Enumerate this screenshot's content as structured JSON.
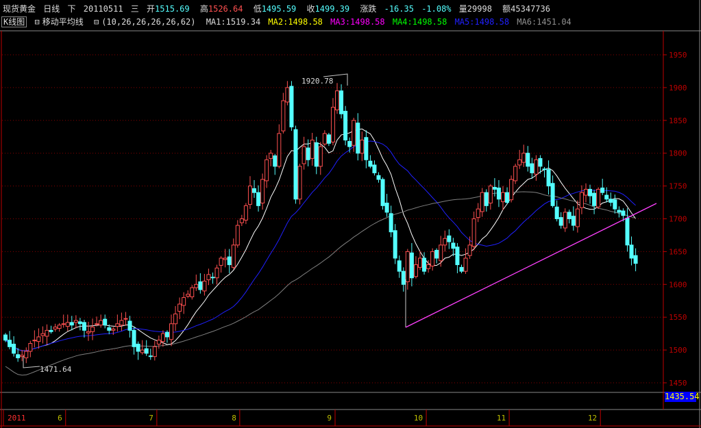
{
  "header": {
    "name": "现货黄金",
    "period": "日线",
    "mode": "下",
    "date": "20110511",
    "weekday": "三",
    "open_label": "开",
    "open": "1515.69",
    "high_label": "高",
    "high": "1526.64",
    "low_label": "低",
    "low": "1495.59",
    "close_label": "收",
    "close": "1499.39",
    "change_label": "涨跌",
    "change": "-16.35",
    "change_pct": "-1.08%",
    "volume_label": "量",
    "volume": "29998",
    "amount_label": "额",
    "amount": "45347736"
  },
  "indicator_bar": {
    "tab_kline": "K线图",
    "tab_ma": "移动平均线",
    "params": "(10,26,26,26,26,62)",
    "ma1": "MA1:1519.34",
    "ma2": "MA2:1498.58",
    "ma3": "MA3:1498.58",
    "ma4": "MA4:1498.58",
    "ma5": "MA5:1498.58",
    "ma6": "MA6:1451.04"
  },
  "last_price_box": "1435.54",
  "colors": {
    "up": "#ff5050",
    "down": "#54ffff",
    "ma1": "#ffffff",
    "ma_blue": "#2020ff",
    "ma6": "#808080",
    "trendline": "#ff40ff",
    "grid": "#8b0000"
  },
  "chart_data": {
    "type": "candlestick",
    "title": "现货黄金 日线",
    "ylim": [
      1430,
      1980
    ],
    "y_ticks": [
      "1950",
      "1900",
      "1850",
      "1800",
      "1750",
      "1700",
      "1650",
      "1600",
      "1550",
      "1500",
      "1450"
    ],
    "x_ticks": [
      {
        "label": "2011",
        "index": 0
      },
      {
        "label": "6",
        "index": 15
      },
      {
        "label": "7",
        "index": 37
      },
      {
        "label": "8",
        "index": 57
      },
      {
        "label": "9",
        "index": 80
      },
      {
        "label": "10",
        "index": 102
      },
      {
        "label": "11",
        "index": 122
      },
      {
        "label": "12",
        "index": 144
      }
    ],
    "close": [
      1515,
      1505,
      1495,
      1488,
      1492,
      1498,
      1510,
      1515,
      1520,
      1525,
      1530,
      1528,
      1535,
      1538,
      1540,
      1542,
      1538,
      1545,
      1540,
      1530,
      1528,
      1535,
      1540,
      1545,
      1538,
      1530,
      1532,
      1540,
      1545,
      1548,
      1530,
      1505,
      1498,
      1500,
      1495,
      1490,
      1505,
      1515,
      1525,
      1520,
      1540,
      1555,
      1570,
      1580,
      1585,
      1595,
      1600,
      1592,
      1605,
      1615,
      1610,
      1625,
      1640,
      1640,
      1630,
      1660,
      1690,
      1700,
      1720,
      1750,
      1740,
      1720,
      1760,
      1790,
      1800,
      1780,
      1830,
      1880,
      1900,
      1840,
      1730,
      1780,
      1810,
      1790,
      1820,
      1780,
      1810,
      1830,
      1815,
      1870,
      1895,
      1860,
      1820,
      1810,
      1850,
      1800,
      1820,
      1790,
      1780,
      1770,
      1760,
      1720,
      1710,
      1680,
      1640,
      1620,
      1600,
      1650,
      1610,
      1630,
      1640,
      1620,
      1630,
      1650,
      1640,
      1660,
      1670,
      1665,
      1655,
      1630,
      1620,
      1640,
      1660,
      1700,
      1715,
      1740,
      1720,
      1750,
      1745,
      1730,
      1740,
      1725,
      1760,
      1780,
      1790,
      1800,
      1780,
      1770,
      1790,
      1780,
      1775,
      1750,
      1720,
      1700,
      1690,
      1710,
      1700,
      1690,
      1715,
      1740,
      1745,
      1735,
      1720,
      1745,
      1740,
      1730,
      1725,
      1715,
      1710,
      1705,
      1660,
      1640,
      1632
    ],
    "ma_periods": [
      10,
      26,
      62
    ],
    "annotations": [
      {
        "text": "1920.78",
        "type": "high"
      },
      {
        "text": "1471.64",
        "type": "low"
      }
    ],
    "trendline": {
      "from": [
        1533,
        96
      ],
      "to": [
        1723,
        157
      ],
      "unit": "price,index"
    }
  }
}
